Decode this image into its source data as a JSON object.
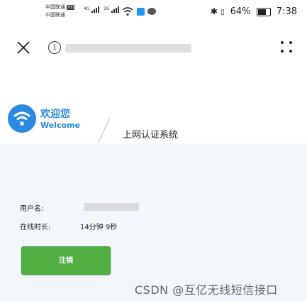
{
  "status_bar": {
    "carrier_1": "中国联通",
    "carrier_1_badge": "HD",
    "carrier_2": "中国联通",
    "signal_1_label": "4G",
    "signal_2_label": "3G",
    "battery_percent": "64%",
    "time": "7:38"
  },
  "header": {
    "welcome_cn": "欢迎您",
    "welcome_en": "Welcome",
    "system_title": "上网认证系统"
  },
  "info": {
    "username_label": "用户名:",
    "online_time_label": "在线时长:",
    "online_time_value": "14分钟 9秒"
  },
  "actions": {
    "logout_label": "注销"
  },
  "watermark": "CSDN @互亿无线短信接口",
  "colors": {
    "brand_blue": "#2a8ae0",
    "button_green": "#52b043",
    "panel_bg": "#f3f7fb"
  }
}
